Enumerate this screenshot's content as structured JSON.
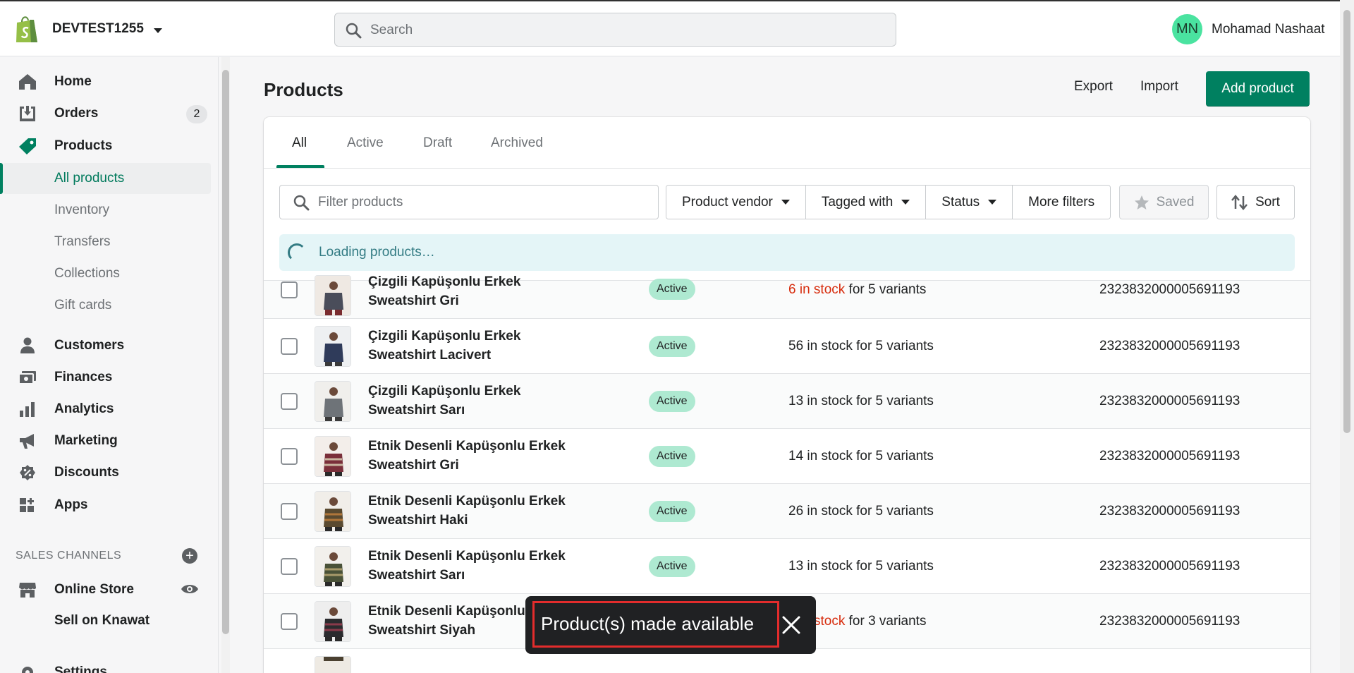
{
  "header": {
    "store_name": "DEVTEST1255",
    "search_placeholder": "Search",
    "user_initials": "MN",
    "user_name": "Mohamad Nashaat"
  },
  "sidebar": {
    "items": [
      {
        "label": "Home",
        "icon": "home-icon"
      },
      {
        "label": "Orders",
        "icon": "orders-icon",
        "badge": "2"
      },
      {
        "label": "Products",
        "icon": "tag-icon"
      },
      {
        "label": "Customers",
        "icon": "person-icon"
      },
      {
        "label": "Finances",
        "icon": "finances-icon"
      },
      {
        "label": "Analytics",
        "icon": "bar-chart-icon"
      },
      {
        "label": "Marketing",
        "icon": "megaphone-icon"
      },
      {
        "label": "Discounts",
        "icon": "discount-icon"
      },
      {
        "label": "Apps",
        "icon": "apps-icon"
      }
    ],
    "product_subitems": [
      "All products",
      "Inventory",
      "Transfers",
      "Collections",
      "Gift cards"
    ],
    "sales_channels_heading": "SALES CHANNELS",
    "channels": [
      {
        "label": "Online Store",
        "icon": "store-icon"
      },
      {
        "label": "Sell on Knawat"
      }
    ],
    "settings_label": "Settings"
  },
  "page": {
    "title": "Products",
    "export_label": "Export",
    "import_label": "Import",
    "add_product_label": "Add product"
  },
  "tabs": [
    "All",
    "Active",
    "Draft",
    "Archived"
  ],
  "filters": {
    "placeholder": "Filter products",
    "vendor": "Product vendor",
    "tagged": "Tagged with",
    "status": "Status",
    "more": "More filters",
    "saved": "Saved",
    "sort": "Sort"
  },
  "loading_text": "Loading products…",
  "products": [
    {
      "name1": "Çizgili Kapüşonlu Erkek",
      "name2": "Sweatshirt Gri",
      "status": "Active",
      "stock_low": "6 in stock",
      "stock_rest": " for 5 variants",
      "sku": "2323832000005691193"
    },
    {
      "name1": "Çizgili Kapüşonlu Erkek",
      "name2": "Sweatshirt Lacivert",
      "status": "Active",
      "stock_low": "",
      "stock_rest": "56 in stock for 5 variants",
      "sku": "2323832000005691193"
    },
    {
      "name1": "Çizgili Kapüşonlu Erkek",
      "name2": "Sweatshirt Sarı",
      "status": "Active",
      "stock_low": "",
      "stock_rest": "13 in stock for 5 variants",
      "sku": "2323832000005691193"
    },
    {
      "name1": "Etnik Desenli Kapüşonlu Erkek",
      "name2": "Sweatshirt Gri",
      "status": "Active",
      "stock_low": "",
      "stock_rest": "14 in stock for 5 variants",
      "sku": "2323832000005691193"
    },
    {
      "name1": "Etnik Desenli Kapüşonlu Erkek",
      "name2": "Sweatshirt Haki",
      "status": "Active",
      "stock_low": "",
      "stock_rest": "26 in stock for 5 variants",
      "sku": "2323832000005691193"
    },
    {
      "name1": "Etnik Desenli Kapüşonlu Erkek",
      "name2": "Sweatshirt Sarı",
      "status": "Active",
      "stock_low": "",
      "stock_rest": "13 in stock for 5 variants",
      "sku": "2323832000005691193"
    },
    {
      "name1": "Etnik Desenli Kapüşonlu",
      "name2": "Sweatshirt Siyah",
      "status": "",
      "stock_low": "stock",
      "stock_rest": " for 3 variants",
      "sku": "2323832000005691193"
    }
  ],
  "toast": {
    "message": "Product(s) made available"
  },
  "colors": {
    "primary": "#008060",
    "badge_active": "#aee9d1",
    "critical": "#d72c0d",
    "toast_bg": "#202123"
  }
}
